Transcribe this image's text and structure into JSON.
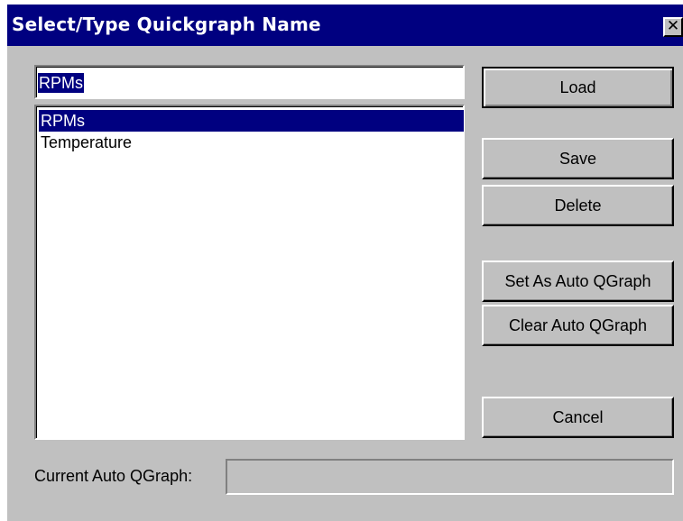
{
  "window": {
    "title": "Select/Type Quickgraph Name",
    "close_icon": "close-icon",
    "close_glyph": "✕"
  },
  "name_input": {
    "value": "RPMs"
  },
  "list": {
    "items": [
      {
        "label": "RPMs",
        "selected": true
      },
      {
        "label": "Temperature",
        "selected": false
      }
    ]
  },
  "buttons": {
    "load": "Load",
    "save": "Save",
    "delete": "Delete",
    "set_auto": "Set As Auto QGraph",
    "clear_auto": "Clear Auto QGraph",
    "cancel": "Cancel"
  },
  "status": {
    "label": "Current Auto QGraph:",
    "value": ""
  },
  "colors": {
    "titlebar": "#000080",
    "dialog_face": "#c0c0c0",
    "selection": "#000080"
  }
}
